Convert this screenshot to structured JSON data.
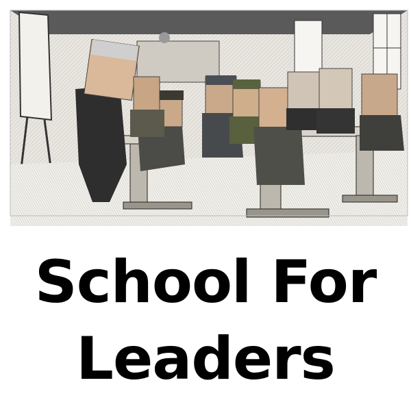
{
  "meme": {
    "caption_line1": "School For",
    "caption_line2": "Leaders"
  },
  "colors": {
    "ink": "#2a2a2a",
    "paper": "#f4f2ee",
    "caption": "#000000"
  },
  "illustration": {
    "scene": "classroom-engraving",
    "figures": 9
  }
}
